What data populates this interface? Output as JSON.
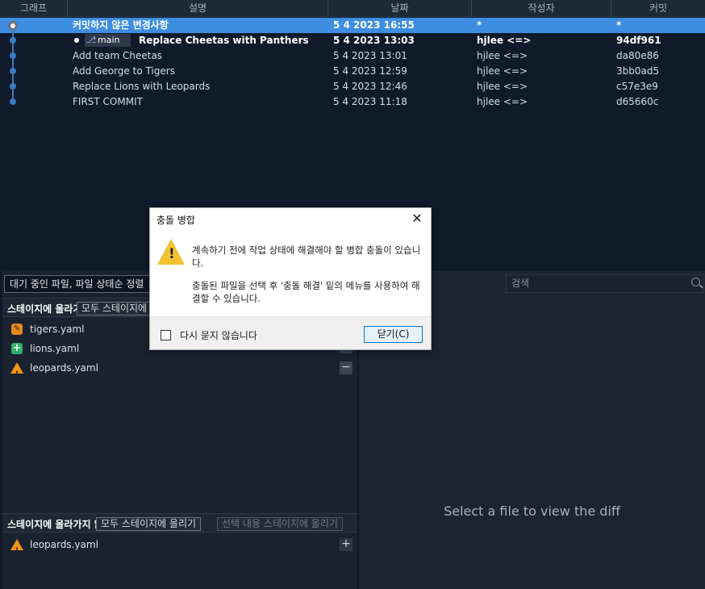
{
  "history": {
    "columns": [
      "그래프",
      "설명",
      "날짜",
      "작성자",
      "커밋"
    ],
    "rows": [
      {
        "desc": "커밋하지 않은 변경사항",
        "date": "5 4 2023 16:55",
        "author": "*",
        "commit": "*"
      },
      {
        "desc": "Replace Cheetas with Panthers",
        "date": "5 4 2023 13:03",
        "author": "hjlee <=>",
        "commit": "94df961",
        "branch": "main"
      },
      {
        "desc": "Add team Cheetas",
        "date": "5 4 2023 13:01",
        "author": "hjlee <=>",
        "commit": "da80e86"
      },
      {
        "desc": "Add George to Tigers",
        "date": "5 4 2023 12:59",
        "author": "hjlee <=>",
        "commit": "3bb0ad5"
      },
      {
        "desc": "Replace Lions with Leopards",
        "date": "5 4 2023 12:46",
        "author": "hjlee <=>",
        "commit": "c57e3e9"
      },
      {
        "desc": "FIRST COMMIT",
        "date": "5 4 2023 11:18",
        "author": "hjlee <=>",
        "commit": "d65660c"
      }
    ]
  },
  "filter": {
    "value": "대기 중인 파일, 파일 상태순 정렬"
  },
  "unstaged": {
    "title": "스테이지에 올라가지 않은 파일",
    "stage_all_label": "모두 스테이지에 올리기",
    "files": [
      {
        "name": "tigers.yaml",
        "status": "modified"
      },
      {
        "name": "lions.yaml",
        "status": "added"
      },
      {
        "name": "leopards.yaml",
        "status": "conflict"
      }
    ]
  },
  "staged": {
    "title": "스테이지에 올라가지 않은 파일",
    "stage_all_label": "모두 스테이지에 올리기",
    "stage_selected_label": "선택 내용 스테이지에 올리기",
    "files": [
      {
        "name": "leopards.yaml",
        "status": "conflict"
      }
    ]
  },
  "search": {
    "placeholder": "검색"
  },
  "diff": {
    "hint": "Select a file to view the diff"
  },
  "dialog": {
    "title": "충돌 병합",
    "message1": "계속하기 전에 작업 상태에 해결해야 할 병합 충돌이 있습니다.",
    "message2": "충돌된 파일을 선택 후 '충돌 해결' 밑의 메뉴를 사용하여 해결할 수 있습니다.",
    "dont_ask_label": "다시 묻지 않습니다",
    "close_label": "닫기(C)"
  },
  "colors": {
    "selected_row": "#3d8de0",
    "graph_line": "#3c7bc2",
    "conflict": "#f0931c",
    "added": "#2fb36b",
    "modified": "#e88a1a"
  }
}
